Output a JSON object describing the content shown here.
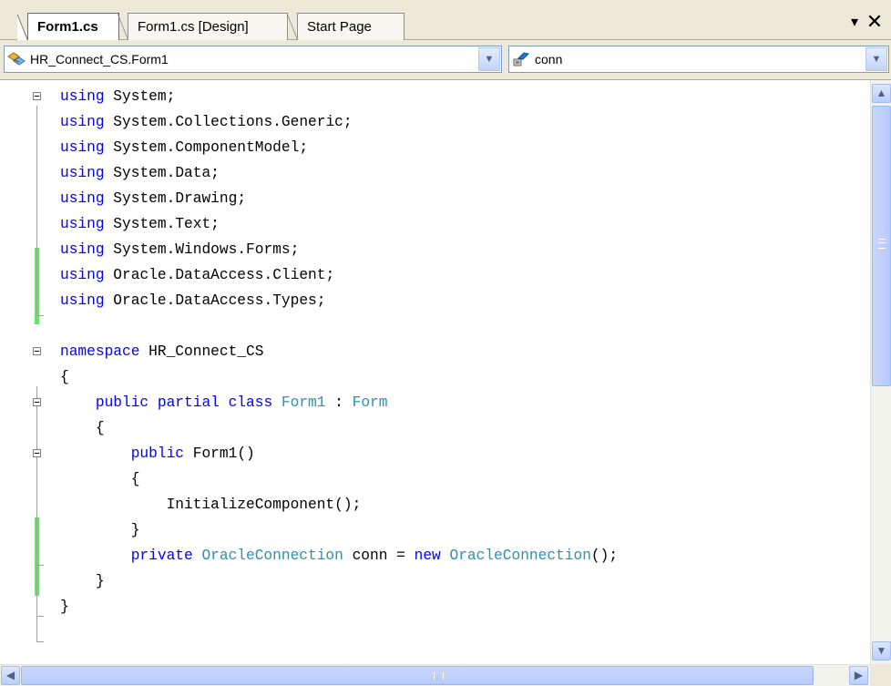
{
  "tabs": [
    {
      "label": "Form1.cs",
      "active": true
    },
    {
      "label": "Form1.cs [Design]",
      "active": false
    },
    {
      "label": "Start Page",
      "active": false
    }
  ],
  "tab_controls": {
    "dropdown_icon": "▾",
    "close_icon": "✕"
  },
  "navigation": {
    "types_combo": "HR_Connect_CS.Form1",
    "members_combo": "conn"
  },
  "colors": {
    "keyword": "#0000ff",
    "type": "#2b91af",
    "changed_line": "#6ce26c"
  },
  "code_lines": [
    "using System;",
    "using System.Collections.Generic;",
    "using System.ComponentModel;",
    "using System.Data;",
    "using System.Drawing;",
    "using System.Text;",
    "using System.Windows.Forms;",
    "using Oracle.DataAccess.Client;",
    "using Oracle.DataAccess.Types;",
    "",
    "namespace HR_Connect_CS",
    "{",
    "    public partial class Form1 : Form",
    "    {",
    "        public Form1()",
    "        {",
    "            InitializeComponent();",
    "        }",
    "        private OracleConnection conn = new OracleConnection();",
    "    }",
    "}"
  ]
}
